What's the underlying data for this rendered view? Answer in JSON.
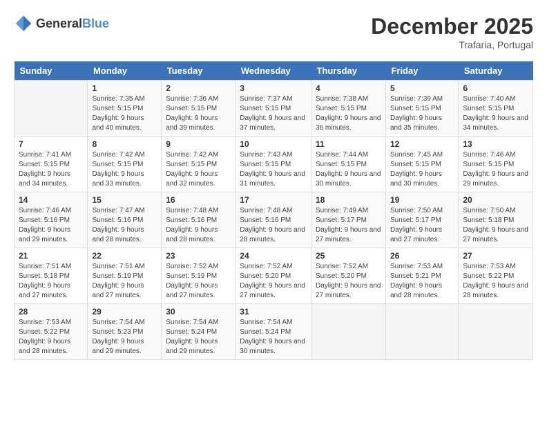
{
  "header": {
    "logo": {
      "general": "General",
      "blue": "Blue"
    },
    "title": "December 2025",
    "location": "Trafaria, Portugal"
  },
  "calendar": {
    "days_of_week": [
      "Sunday",
      "Monday",
      "Tuesday",
      "Wednesday",
      "Thursday",
      "Friday",
      "Saturday"
    ],
    "weeks": [
      [
        {
          "day": "",
          "sunrise": "",
          "sunset": "",
          "daylight": "",
          "empty": true
        },
        {
          "day": "1",
          "sunrise": "Sunrise: 7:35 AM",
          "sunset": "Sunset: 5:15 PM",
          "daylight": "Daylight: 9 hours and 40 minutes.",
          "empty": false
        },
        {
          "day": "2",
          "sunrise": "Sunrise: 7:36 AM",
          "sunset": "Sunset: 5:15 PM",
          "daylight": "Daylight: 9 hours and 39 minutes.",
          "empty": false
        },
        {
          "day": "3",
          "sunrise": "Sunrise: 7:37 AM",
          "sunset": "Sunset: 5:15 PM",
          "daylight": "Daylight: 9 hours and 37 minutes.",
          "empty": false
        },
        {
          "day": "4",
          "sunrise": "Sunrise: 7:38 AM",
          "sunset": "Sunset: 5:15 PM",
          "daylight": "Daylight: 9 hours and 36 minutes.",
          "empty": false
        },
        {
          "day": "5",
          "sunrise": "Sunrise: 7:39 AM",
          "sunset": "Sunset: 5:15 PM",
          "daylight": "Daylight: 9 hours and 35 minutes.",
          "empty": false
        },
        {
          "day": "6",
          "sunrise": "Sunrise: 7:40 AM",
          "sunset": "Sunset: 5:15 PM",
          "daylight": "Daylight: 9 hours and 34 minutes.",
          "empty": false
        }
      ],
      [
        {
          "day": "7",
          "sunrise": "Sunrise: 7:41 AM",
          "sunset": "Sunset: 5:15 PM",
          "daylight": "Daylight: 9 hours and 34 minutes.",
          "empty": false
        },
        {
          "day": "8",
          "sunrise": "Sunrise: 7:42 AM",
          "sunset": "Sunset: 5:15 PM",
          "daylight": "Daylight: 9 hours and 33 minutes.",
          "empty": false
        },
        {
          "day": "9",
          "sunrise": "Sunrise: 7:42 AM",
          "sunset": "Sunset: 5:15 PM",
          "daylight": "Daylight: 9 hours and 32 minutes.",
          "empty": false
        },
        {
          "day": "10",
          "sunrise": "Sunrise: 7:43 AM",
          "sunset": "Sunset: 5:15 PM",
          "daylight": "Daylight: 9 hours and 31 minutes.",
          "empty": false
        },
        {
          "day": "11",
          "sunrise": "Sunrise: 7:44 AM",
          "sunset": "Sunset: 5:15 PM",
          "daylight": "Daylight: 9 hours and 30 minutes.",
          "empty": false
        },
        {
          "day": "12",
          "sunrise": "Sunrise: 7:45 AM",
          "sunset": "Sunset: 5:15 PM",
          "daylight": "Daylight: 9 hours and 30 minutes.",
          "empty": false
        },
        {
          "day": "13",
          "sunrise": "Sunrise: 7:46 AM",
          "sunset": "Sunset: 5:15 PM",
          "daylight": "Daylight: 9 hours and 29 minutes.",
          "empty": false
        }
      ],
      [
        {
          "day": "14",
          "sunrise": "Sunrise: 7:46 AM",
          "sunset": "Sunset: 5:16 PM",
          "daylight": "Daylight: 9 hours and 29 minutes.",
          "empty": false
        },
        {
          "day": "15",
          "sunrise": "Sunrise: 7:47 AM",
          "sunset": "Sunset: 5:16 PM",
          "daylight": "Daylight: 9 hours and 28 minutes.",
          "empty": false
        },
        {
          "day": "16",
          "sunrise": "Sunrise: 7:48 AM",
          "sunset": "Sunset: 5:16 PM",
          "daylight": "Daylight: 9 hours and 28 minutes.",
          "empty": false
        },
        {
          "day": "17",
          "sunrise": "Sunrise: 7:48 AM",
          "sunset": "Sunset: 5:16 PM",
          "daylight": "Daylight: 9 hours and 28 minutes.",
          "empty": false
        },
        {
          "day": "18",
          "sunrise": "Sunrise: 7:49 AM",
          "sunset": "Sunset: 5:17 PM",
          "daylight": "Daylight: 9 hours and 27 minutes.",
          "empty": false
        },
        {
          "day": "19",
          "sunrise": "Sunrise: 7:50 AM",
          "sunset": "Sunset: 5:17 PM",
          "daylight": "Daylight: 9 hours and 27 minutes.",
          "empty": false
        },
        {
          "day": "20",
          "sunrise": "Sunrise: 7:50 AM",
          "sunset": "Sunset: 5:18 PM",
          "daylight": "Daylight: 9 hours and 27 minutes.",
          "empty": false
        }
      ],
      [
        {
          "day": "21",
          "sunrise": "Sunrise: 7:51 AM",
          "sunset": "Sunset: 5:18 PM",
          "daylight": "Daylight: 9 hours and 27 minutes.",
          "empty": false
        },
        {
          "day": "22",
          "sunrise": "Sunrise: 7:51 AM",
          "sunset": "Sunset: 5:19 PM",
          "daylight": "Daylight: 9 hours and 27 minutes.",
          "empty": false
        },
        {
          "day": "23",
          "sunrise": "Sunrise: 7:52 AM",
          "sunset": "Sunset: 5:19 PM",
          "daylight": "Daylight: 9 hours and 27 minutes.",
          "empty": false
        },
        {
          "day": "24",
          "sunrise": "Sunrise: 7:52 AM",
          "sunset": "Sunset: 5:20 PM",
          "daylight": "Daylight: 9 hours and 27 minutes.",
          "empty": false
        },
        {
          "day": "25",
          "sunrise": "Sunrise: 7:52 AM",
          "sunset": "Sunset: 5:20 PM",
          "daylight": "Daylight: 9 hours and 27 minutes.",
          "empty": false
        },
        {
          "day": "26",
          "sunrise": "Sunrise: 7:53 AM",
          "sunset": "Sunset: 5:21 PM",
          "daylight": "Daylight: 9 hours and 28 minutes.",
          "empty": false
        },
        {
          "day": "27",
          "sunrise": "Sunrise: 7:53 AM",
          "sunset": "Sunset: 5:22 PM",
          "daylight": "Daylight: 9 hours and 28 minutes.",
          "empty": false
        }
      ],
      [
        {
          "day": "28",
          "sunrise": "Sunrise: 7:53 AM",
          "sunset": "Sunset: 5:22 PM",
          "daylight": "Daylight: 9 hours and 28 minutes.",
          "empty": false
        },
        {
          "day": "29",
          "sunrise": "Sunrise: 7:54 AM",
          "sunset": "Sunset: 5:23 PM",
          "daylight": "Daylight: 9 hours and 29 minutes.",
          "empty": false
        },
        {
          "day": "30",
          "sunrise": "Sunrise: 7:54 AM",
          "sunset": "Sunset: 5:24 PM",
          "daylight": "Daylight: 9 hours and 29 minutes.",
          "empty": false
        },
        {
          "day": "31",
          "sunrise": "Sunrise: 7:54 AM",
          "sunset": "Sunset: 5:24 PM",
          "daylight": "Daylight: 9 hours and 30 minutes.",
          "empty": false
        },
        {
          "day": "",
          "sunrise": "",
          "sunset": "",
          "daylight": "",
          "empty": true
        },
        {
          "day": "",
          "sunrise": "",
          "sunset": "",
          "daylight": "",
          "empty": true
        },
        {
          "day": "",
          "sunrise": "",
          "sunset": "",
          "daylight": "",
          "empty": true
        }
      ]
    ]
  }
}
